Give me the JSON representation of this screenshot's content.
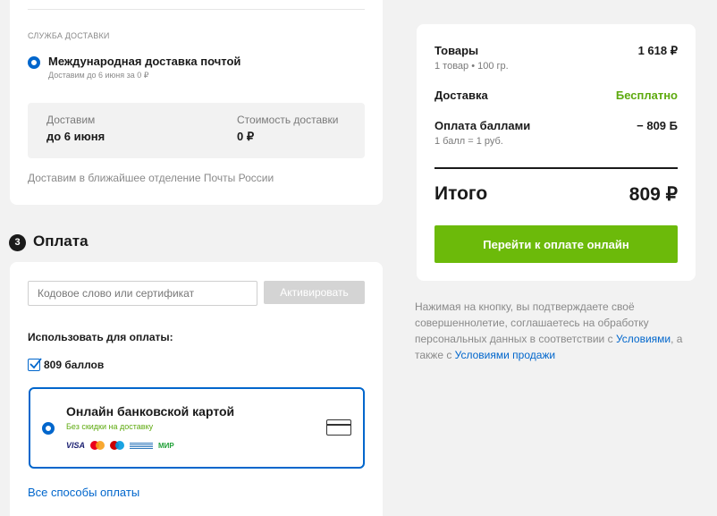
{
  "delivery": {
    "service_label": "Служба доставки",
    "option_title": "Международная доставка почтой",
    "option_sub": "Доставим до 6 июня за 0 ₽",
    "info": {
      "when_label": "Доставим",
      "when_value": "до 6 июня",
      "cost_label": "Стоимость доставки",
      "cost_value": "0 ₽"
    },
    "note": "Доставим в ближайшее отделение Почты России"
  },
  "payment": {
    "step": "3",
    "title": "Оплата",
    "promo_placeholder": "Кодовое слово или сертификат",
    "activate_label": "Активировать",
    "use_label": "Использовать для оплаты:",
    "points_label": "809 баллов",
    "points_checked": true,
    "option_title": "Онлайн банковской картой",
    "option_sub": "Без скидки на доставку",
    "logos": {
      "visa": "VISA",
      "mir": "МИР"
    },
    "all_methods": "Все способы оплаты"
  },
  "summary": {
    "goods_label": "Товары",
    "goods_value": "1 618 ₽",
    "goods_sub": "1 товар • 100 гр.",
    "delivery_label": "Доставка",
    "delivery_value": "Бесплатно",
    "points_label": "Оплата баллами",
    "points_value": "− 809 Б",
    "points_sub": "1 балл = 1 руб.",
    "total_label": "Итого",
    "total_value": "809 ₽",
    "button": "Перейти к оплате онлайн"
  },
  "legal": {
    "text1": "Нажимая на кнопку, вы подтверждаете своё совершеннолетие, соглашаетесь на обработку персональных данных в соответствии с ",
    "link1": "Условиями",
    "text2": ", а также с ",
    "link2": "Условиями продажи"
  },
  "colors": {
    "accent": "#0066cc",
    "green": "#6cba0a",
    "background": "#f2f2f2"
  }
}
